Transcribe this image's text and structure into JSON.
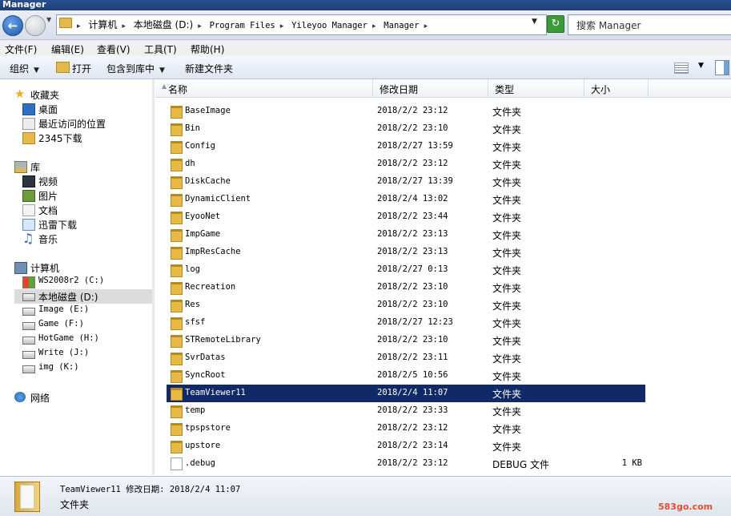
{
  "window": {
    "title": "Manager"
  },
  "address": {
    "crumbs": [
      "计算机",
      "本地磁盘 (D:)",
      "Program Files",
      "Yileyoo Manager",
      "Manager"
    ],
    "search_placeholder": "搜索 Manager"
  },
  "menu": [
    "文件(F)",
    "编辑(E)",
    "查看(V)",
    "工具(T)",
    "帮助(H)"
  ],
  "toolbar": {
    "organize": "组织",
    "open": "打开",
    "include_in_library": "包含到库中",
    "new_folder": "新建文件夹"
  },
  "nav": {
    "favorites": {
      "label": "收藏夹",
      "items": [
        "桌面",
        "最近访问的位置",
        "2345下载"
      ]
    },
    "libraries": {
      "label": "库",
      "items": [
        "视频",
        "图片",
        "文档",
        "迅雷下载",
        "音乐"
      ]
    },
    "computer": {
      "label": "计算机",
      "items": [
        "WS2008r2 (C:)",
        "本地磁盘 (D:)",
        "Image (E:)",
        "Game (F:)",
        "HotGame (H:)",
        "Write (J:)",
        "img (K:)"
      ]
    },
    "network": {
      "label": "网络"
    }
  },
  "columns": {
    "name": "名称",
    "date": "修改日期",
    "type": "类型",
    "size": "大小"
  },
  "files": [
    {
      "name": "BaseImage",
      "date": "2018/2/2 23:12",
      "type": "文件夹",
      "size": ""
    },
    {
      "name": "Bin",
      "date": "2018/2/2 23:10",
      "type": "文件夹",
      "size": ""
    },
    {
      "name": "Config",
      "date": "2018/2/27 13:59",
      "type": "文件夹",
      "size": ""
    },
    {
      "name": "dh",
      "date": "2018/2/2 23:12",
      "type": "文件夹",
      "size": ""
    },
    {
      "name": "DiskCache",
      "date": "2018/2/27 13:39",
      "type": "文件夹",
      "size": ""
    },
    {
      "name": "DynamicClient",
      "date": "2018/2/4 13:02",
      "type": "文件夹",
      "size": ""
    },
    {
      "name": "EyooNet",
      "date": "2018/2/2 23:44",
      "type": "文件夹",
      "size": ""
    },
    {
      "name": "ImpGame",
      "date": "2018/2/2 23:13",
      "type": "文件夹",
      "size": ""
    },
    {
      "name": "ImpResCache",
      "date": "2018/2/2 23:13",
      "type": "文件夹",
      "size": ""
    },
    {
      "name": "log",
      "date": "2018/2/27 0:13",
      "type": "文件夹",
      "size": ""
    },
    {
      "name": "Recreation",
      "date": "2018/2/2 23:10",
      "type": "文件夹",
      "size": ""
    },
    {
      "name": "Res",
      "date": "2018/2/2 23:10",
      "type": "文件夹",
      "size": ""
    },
    {
      "name": "sfsf",
      "date": "2018/2/27 12:23",
      "type": "文件夹",
      "size": ""
    },
    {
      "name": "STRemoteLibrary",
      "date": "2018/2/2 23:10",
      "type": "文件夹",
      "size": ""
    },
    {
      "name": "SvrDatas",
      "date": "2018/2/2 23:11",
      "type": "文件夹",
      "size": ""
    },
    {
      "name": "SyncRoot",
      "date": "2018/2/5 10:56",
      "type": "文件夹",
      "size": ""
    },
    {
      "name": "TeamViewer11",
      "date": "2018/2/4 11:07",
      "type": "文件夹",
      "size": ""
    },
    {
      "name": "temp",
      "date": "2018/2/2 23:33",
      "type": "文件夹",
      "size": ""
    },
    {
      "name": "tpspstore",
      "date": "2018/2/2 23:12",
      "type": "文件夹",
      "size": ""
    },
    {
      "name": "upstore",
      "date": "2018/2/2 23:14",
      "type": "文件夹",
      "size": ""
    },
    {
      "name": ".debug",
      "date": "2018/2/2 23:12",
      "type": "DEBUG 文件",
      "size": "1 KB"
    }
  ],
  "details": {
    "name_line": "TeamViewer11 修改日期: 2018/2/4 11:07",
    "type_line": "文件夹"
  },
  "watermark": "583go.com"
}
